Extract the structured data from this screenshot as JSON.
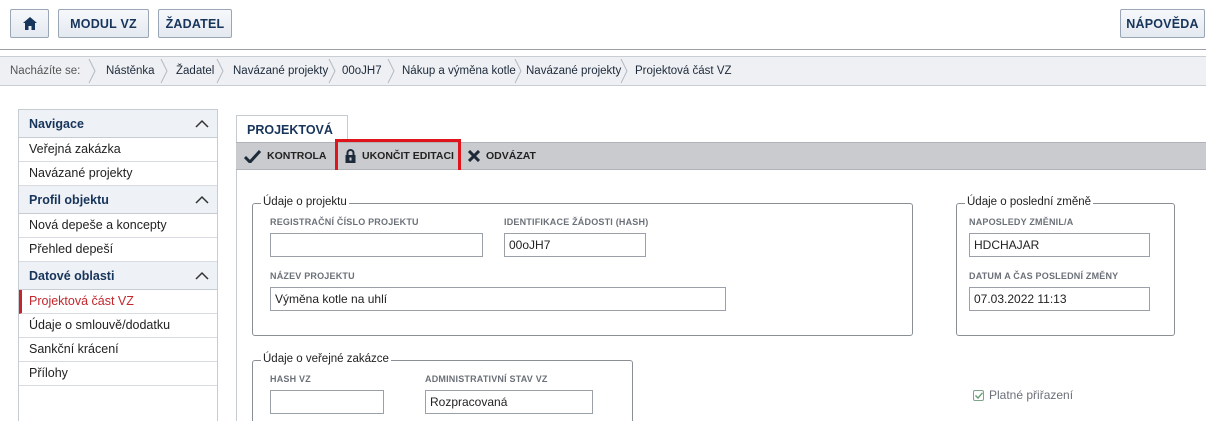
{
  "topbar": {
    "home_icon": "home-icon",
    "modul_label": "MODUL VZ",
    "zadatel_label": "ŽADATEL",
    "napoveda_label": "NÁPOVĚDA"
  },
  "breadcrumb": {
    "lead": "Nacházíte se:",
    "items": [
      "Nástěnka",
      "Žadatel",
      "Navázané projekty",
      "00oJH7",
      "Nákup a výměna kotle",
      "Navázané projekty",
      "Projektová část VZ"
    ]
  },
  "sidebar": {
    "sections": [
      {
        "title": "Navigace",
        "items": [
          "Veřejná zakázka",
          "Navázané projekty"
        ]
      },
      {
        "title": "Profil objektu",
        "items": [
          "Nová depeše a koncepty",
          "Přehled depeší"
        ]
      },
      {
        "title": "Datové oblasti",
        "items": [
          "Projektová část VZ",
          "Údaje o smlouvě/dodatku",
          "Sankční krácení",
          "Přílohy"
        ]
      }
    ],
    "active_item": "Projektová část VZ"
  },
  "main": {
    "tab_label": "PROJEKTOVÁ ČÁST VZ",
    "toolbar": {
      "kontrola": "KONTROLA",
      "ukoncit": "UKONČIT EDITACI",
      "odvazat": "ODVÁZAT"
    },
    "projekt": {
      "legend": "Údaje o projektu",
      "reg_label": "REGISTRAČNÍ ČÍSLO PROJEKTU",
      "reg_value": "",
      "hash_label": "IDENTIFIKACE ŽÁDOSTI (HASH)",
      "hash_value": "00oJH7",
      "nazev_label": "NÁZEV PROJEKTU",
      "nazev_value": "Výměna kotle na uhlí"
    },
    "zmena": {
      "legend": "Údaje o poslední změně",
      "zmenil_label": "NAPOSLEDY ZMĚNIL/A",
      "zmenil_value": "HDCHAJAR",
      "datum_label": "DATUM A ČAS POSLEDNÍ ZMĚNY",
      "datum_value": "07.03.2022 11:13"
    },
    "vz": {
      "legend": "Údaje o veřejné zakázce",
      "hashvz_label": "HASH VZ",
      "hashvz_value": "",
      "stav_label": "ADMINISTRATIVNÍ STAV VZ",
      "stav_value": "Rozpracovaná"
    },
    "platne_label": "Platné přiřazení",
    "platne_checked": true,
    "accent_color": "#c2272d",
    "highlight_color": "#e0141b"
  }
}
